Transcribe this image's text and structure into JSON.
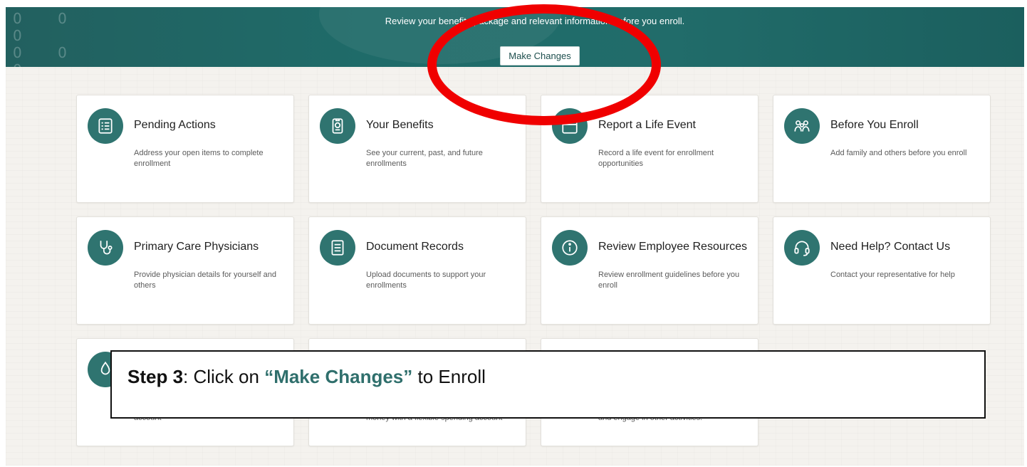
{
  "banner": {
    "text": "Review your benefits package and relevant information before you enroll.",
    "button_label": "Make Changes"
  },
  "cards": [
    {
      "title": "Pending Actions",
      "desc": "Address your open items to complete enrollment",
      "icon": "checklist-icon"
    },
    {
      "title": "Your Benefits",
      "desc": "See your current, past, and future enrollments",
      "icon": "badge-icon"
    },
    {
      "title": "Report a Life Event",
      "desc": "Record a life event for enrollment opportunities",
      "icon": "calendar-icon"
    },
    {
      "title": "Before You Enroll",
      "desc": "Add family and others before you enroll",
      "icon": "family-icon"
    },
    {
      "title": "Primary Care Physicians",
      "desc": "Provide physician details for yourself and others",
      "icon": "stethoscope-icon"
    },
    {
      "title": "Document Records",
      "desc": "Upload documents to support your enrollments",
      "icon": "document-icon"
    },
    {
      "title": "Review Employee Resources",
      "desc": "Review enrollment guidelines before you enroll",
      "icon": "info-icon"
    },
    {
      "title": "Need Help? Contact Us",
      "desc": "Contact your representative for help",
      "icon": "headset-icon"
    },
    {
      "title": "",
      "desc": "account",
      "icon": "savings-icon"
    },
    {
      "title": "",
      "desc": "money with a flexible spending account",
      "icon": ""
    },
    {
      "title": "",
      "desc": "and engage in other activities.",
      "icon": ""
    }
  ],
  "step_callout": {
    "label": "Step 3",
    "before": ": Click on ",
    "link": "“Make Changes”",
    "after": " to Enroll"
  },
  "colors": {
    "banner_teal": "#216c6a",
    "icon_teal": "#2f7470",
    "highlight_red": "#f00000",
    "page_bg": "#f4f2ee"
  }
}
